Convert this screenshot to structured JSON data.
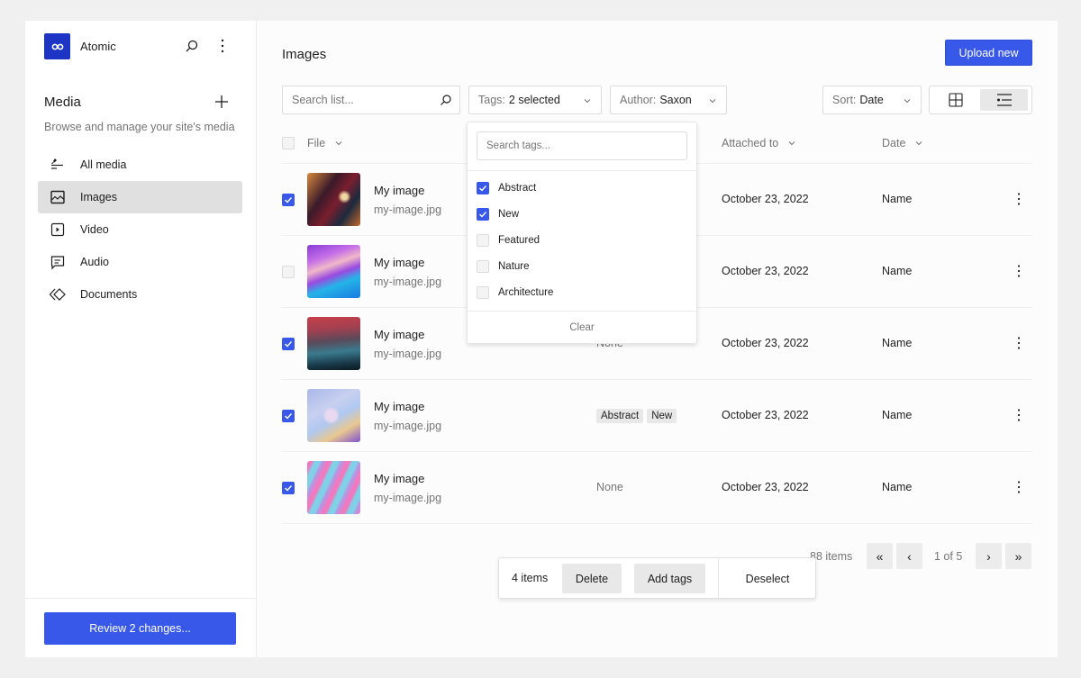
{
  "app": {
    "name": "Atomic"
  },
  "sidebar": {
    "title": "Media",
    "description": "Browse and manage your site's media",
    "items": [
      {
        "label": "All media",
        "icon": "pin-list-icon",
        "active": false
      },
      {
        "label": "Images",
        "icon": "image-icon",
        "active": true
      },
      {
        "label": "Video",
        "icon": "video-icon",
        "active": false
      },
      {
        "label": "Audio",
        "icon": "audio-icon",
        "active": false
      },
      {
        "label": "Documents",
        "icon": "documents-icon",
        "active": false
      }
    ],
    "review_button": "Review 2 changes..."
  },
  "header": {
    "title": "Images",
    "upload_button": "Upload new"
  },
  "filters": {
    "search_placeholder": "Search list...",
    "tags_label": "Tags:",
    "tags_value": "2 selected",
    "author_label": "Author:",
    "author_value": "Saxon",
    "sort_label": "Sort:",
    "sort_value": "Date"
  },
  "columns": {
    "file": "File",
    "attached": "Attached to",
    "date": "Date"
  },
  "rows": [
    {
      "checked": true,
      "name": "My image",
      "file": "my-image.jpg",
      "tags": "",
      "date": "October 23, 2022",
      "author": "Name"
    },
    {
      "checked": false,
      "name": "My image",
      "file": "my-image.jpg",
      "tags": "",
      "date": "October 23, 2022",
      "author": "Name"
    },
    {
      "checked": true,
      "name": "My image",
      "file": "my-image.jpg",
      "tags": "None",
      "date": "October 23, 2022",
      "author": "Name"
    },
    {
      "checked": true,
      "name": "My image",
      "file": "my-image.jpg",
      "tag_chips": [
        "Abstract",
        "New"
      ],
      "date": "October 23, 2022",
      "author": "Name"
    },
    {
      "checked": true,
      "name": "My image",
      "file": "my-image.jpg",
      "tags": "None",
      "date": "October 23, 2022",
      "author": "Name"
    }
  ],
  "tags_dropdown": {
    "search_placeholder": "Search tags...",
    "options": [
      {
        "label": "Abstract",
        "checked": true
      },
      {
        "label": "New",
        "checked": true
      },
      {
        "label": "Featured",
        "checked": false
      },
      {
        "label": "Nature",
        "checked": false
      },
      {
        "label": "Architecture",
        "checked": false
      }
    ],
    "clear": "Clear"
  },
  "pagination": {
    "count": "88 items",
    "page": "1 of 5",
    "first": "«",
    "prev": "‹",
    "next": "›",
    "last": "»"
  },
  "bulk": {
    "count": "4 items",
    "delete": "Delete",
    "add_tags": "Add tags",
    "deselect": "Deselect"
  },
  "colors": {
    "accent": "#3858e9",
    "logo": "#1d35c4"
  }
}
